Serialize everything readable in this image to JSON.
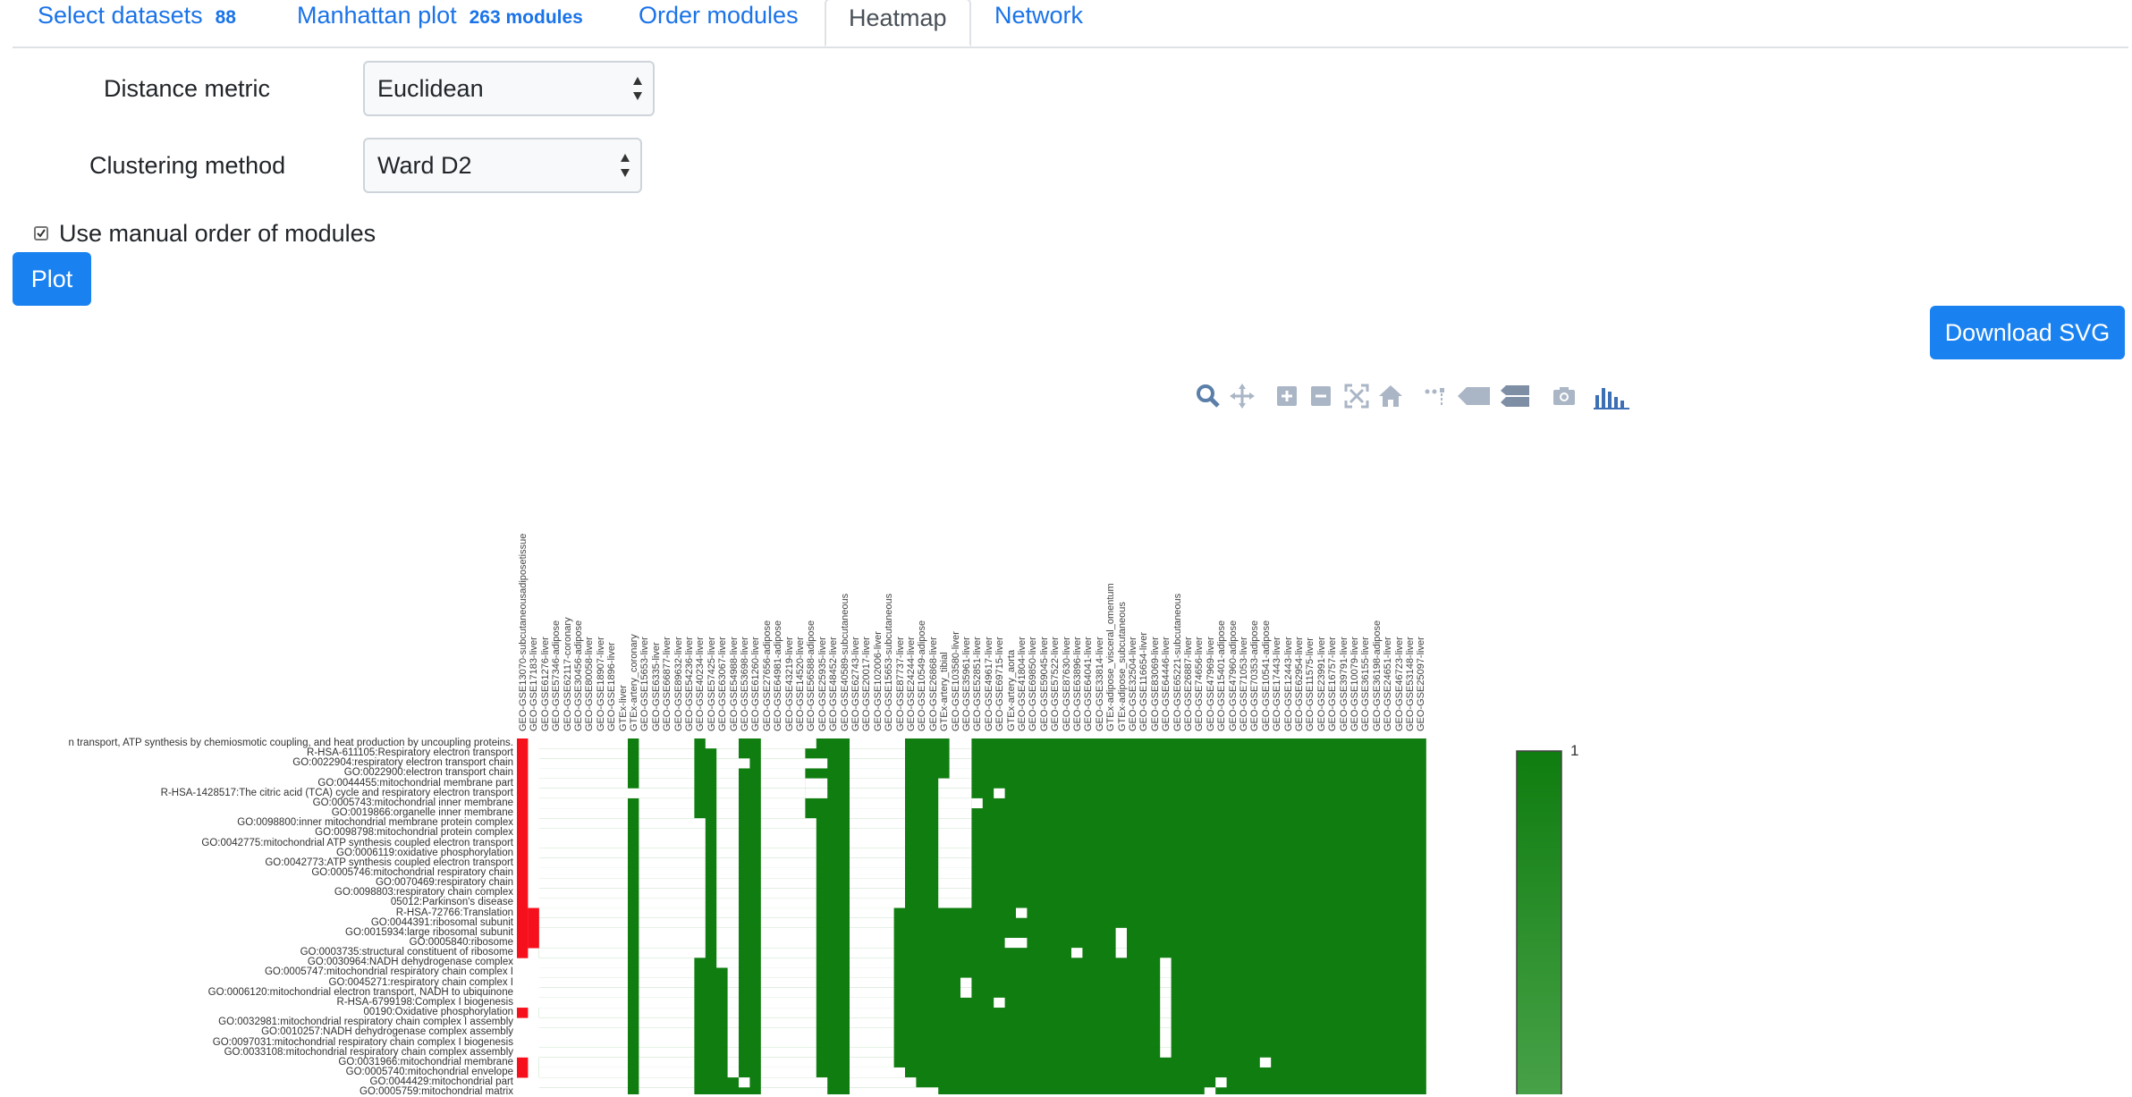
{
  "tabs": [
    {
      "label": "Select datasets",
      "badge": "88",
      "active": false
    },
    {
      "label": "Manhattan plot",
      "badge": "263 modules",
      "active": false
    },
    {
      "label": "Order modules",
      "badge": "",
      "active": false
    },
    {
      "label": "Heatmap",
      "badge": "",
      "active": true
    },
    {
      "label": "Network",
      "badge": "",
      "active": false
    }
  ],
  "form": {
    "distance_label": "Distance metric",
    "distance_value": "Euclidean",
    "clustering_label": "Clustering method",
    "clustering_value": "Ward D2",
    "manual_order_label": "Use manual order of modules",
    "manual_order_checked": true,
    "plot_button": "Plot",
    "download_button": "Download SVG"
  },
  "toolbar": {
    "icons": [
      "zoom-icon",
      "pan-icon",
      "zoom-in-icon",
      "zoom-out-icon",
      "autoscale-icon",
      "reset-axes-icon",
      "spike-lines-icon",
      "hover-closest-icon",
      "hover-compare-icon",
      "camera-icon",
      "plotly-logo-icon"
    ]
  },
  "colors": {
    "accent": "#1a82f0",
    "heat_green": "#0f7d0f",
    "heat_red": "#f5101c",
    "scale_light": "#4aa34a"
  },
  "heatmap": {
    "colorbar_max_label": "1",
    "columns": [
      "GEO-GSE13070-subcutaneousadiposetissue",
      "GEO-GSE17183-liver",
      "GEO-GSE61276-liver",
      "GEO-GSE57346-adipose",
      "GEO-GSE62117-coronary",
      "GEO-GSE30456-adipose",
      "GEO-GSE80058-liver",
      "GEO-GSE18907-liver",
      "GEO-GSE1896-liver",
      "GTEx-liver",
      "GTEx-artery_coronary",
      "GEO-GSE15653-liver",
      "GEO-GSE6335-liver",
      "GEO-GSE66877-liver",
      "GEO-GSE89632-liver",
      "GEO-GSE54236-liver",
      "GEO-GSE40234-liver",
      "GEO-GSE57425-liver",
      "GEO-GSE63067-liver",
      "GEO-GSE54988-liver",
      "GEO-GSE53698-liver",
      "GEO-GSE61260-liver",
      "GEO-GSE27656-adipose",
      "GEO-GSE64981-adipose",
      "GEO-GSE43219-liver",
      "GEO-GSE14520-liver",
      "GEO-GSE56588-adipose",
      "GEO-GSE25935-liver",
      "GEO-GSE48452-liver",
      "GEO-GSE40589-subcutaneous",
      "GEO-GSE62743-liver",
      "GEO-GSE20017-liver",
      "GEO-GSE102006-liver",
      "GEO-GSE15653-subcutaneous",
      "GEO-GSE87737-liver",
      "GEO-GSE24244-liver",
      "GEO-GSE10549-adipose",
      "GEO-GSE26868-liver",
      "GTEx-artery_tibial",
      "GEO-GSE103580-liver",
      "GEO-GSE35961-liver",
      "GEO-GSE52851-liver",
      "GEO-GSE49617-liver",
      "GEO-GSE69715-liver",
      "GTEx-artery_aorta",
      "GEO-GSE41804-liver",
      "GEO-GSE69850-liver",
      "GEO-GSE59045-liver",
      "GEO-GSE57522-liver",
      "GEO-GSE87630-liver",
      "GEO-GSE63896-liver",
      "GEO-GSE64041-liver",
      "GEO-GSE33814-liver",
      "GTEx-adipose_visceral_omentum",
      "GTEx-adipose_subcutaneous",
      "GEO-GSE32504-liver",
      "GEO-GSE116654-liver",
      "GEO-GSE83069-liver",
      "GEO-GSE64446-liver",
      "GEO-GSE65221-subcutaneous",
      "GEO-GSE26887-liver",
      "GEO-GSE74656-liver",
      "GEO-GSE47969-liver",
      "GEO-GSE15401-adipose",
      "GEO-GSE47960-adipose",
      "GEO-GSE71053-liver",
      "GEO-GSE70353-adipose",
      "GEO-GSE10541-adipose",
      "GEO-GSE17443-liver",
      "GEO-GSE12443-liver",
      "GEO-GSE62954-liver",
      "GEO-GSE11575-liver",
      "GEO-GSE23991-liver",
      "GEO-GSE16757-liver",
      "GEO-GSE39791-liver",
      "GEO-GSE10079-liver",
      "GEO-GSE36155-liver",
      "GEO-GSE36198-adipose",
      "GEO-GSE24651-liver",
      "GEO-GSE46723-liver",
      "GEO-GSE53148-liver",
      "GEO-GSE25097-liver"
    ],
    "rows": [
      "n transport, ATP synthesis by chemiosmotic coupling, and heat production by uncoupling proteins.",
      "R-HSA-611105:Respiratory electron transport",
      "GO:0022904:respiratory electron transport chain",
      "GO:0022900:electron transport chain",
      "GO:0044455:mitochondrial membrane part",
      "R-HSA-1428517:The citric acid (TCA) cycle and respiratory electron transport",
      "GO:0005743:mitochondrial inner membrane",
      "GO:0019866:organelle inner membrane",
      "GO:0098800:inner mitochondrial membrane protein complex",
      "GO:0098798:mitochondrial protein complex",
      "GO:0042775:mitochondrial ATP synthesis coupled electron transport",
      "GO:0006119:oxidative phosphorylation",
      "GO:0042773:ATP synthesis coupled electron transport",
      "GO:0005746:mitochondrial respiratory chain",
      "GO:0070469:respiratory chain",
      "GO:0098803:respiratory chain complex",
      "05012:Parkinson's disease",
      "R-HSA-72766:Translation",
      "GO:0044391:ribosomal subunit",
      "GO:0015934:large ribosomal subunit",
      "GO:0005840:ribosome",
      "GO:0003735:structural constituent of ribosome",
      "GO:0030964:NADH dehydrogenase complex",
      "GO:0005747:mitochondrial respiratory chain complex I",
      "GO:0045271:respiratory chain complex I",
      "GO:0006120:mitochondrial electron transport, NADH to ubiquinone",
      "R-HSA-6799198:Complex I biogenesis",
      "00190:Oxidative phosphorylation",
      "GO:0032981:mitochondrial respiratory chain complex I assembly",
      "GO:0010257:NADH dehydrogenase complex assembly",
      "GO:0097031:mitochondrial respiratory chain complex I biogenesis",
      "GO:0033108:mitochondrial respiratory chain complex assembly",
      "GO:0031966:mitochondrial membrane",
      "GO:0005740:mitochondrial envelope",
      "GO:0044429:mitochondrial part",
      "GO:0005759:mitochondrial matrix"
    ]
  },
  "chart_data": {
    "type": "heatmap",
    "x": "heatmap.columns",
    "y": "heatmap.rows",
    "zmax": 1,
    "colorscale": [
      "white",
      "green"
    ],
    "white_cells_by_row": [
      [
        [
          1,
          9
        ],
        [
          11,
          15
        ],
        [
          17,
          19
        ],
        [
          22,
          26
        ],
        [
          30,
          34
        ],
        [
          39,
          40
        ]
      ],
      [
        [
          1,
          9
        ],
        [
          11,
          15
        ],
        [
          18,
          19
        ],
        [
          22,
          25
        ],
        [
          30,
          34
        ],
        [
          39,
          40
        ]
      ],
      [
        [
          1,
          9
        ],
        [
          11,
          15
        ],
        [
          18,
          20
        ],
        [
          22,
          27
        ],
        [
          30,
          34
        ],
        [
          39,
          40
        ]
      ],
      [
        [
          1,
          9
        ],
        [
          11,
          15
        ],
        [
          18,
          19
        ],
        [
          22,
          25
        ],
        [
          30,
          34
        ],
        [
          39,
          40
        ]
      ],
      [
        [
          1,
          9
        ],
        [
          11,
          15
        ],
        [
          18,
          19
        ],
        [
          22,
          25
        ],
        [
          26,
          27
        ],
        [
          30,
          34
        ],
        [
          38,
          40
        ]
      ],
      [
        [
          1,
          9
        ],
        [
          10,
          15
        ],
        [
          18,
          19
        ],
        [
          22,
          25
        ],
        [
          26,
          27
        ],
        [
          30,
          34
        ],
        [
          38,
          40
        ],
        [
          43,
          43
        ]
      ],
      [
        [
          1,
          9
        ],
        [
          11,
          15
        ],
        [
          18,
          19
        ],
        [
          22,
          25
        ],
        [
          30,
          34
        ],
        [
          38,
          40
        ],
        [
          41,
          41
        ]
      ],
      [
        [
          1,
          9
        ],
        [
          11,
          15
        ],
        [
          18,
          19
        ],
        [
          22,
          25
        ],
        [
          30,
          34
        ],
        [
          38,
          40
        ]
      ],
      [
        [
          1,
          9
        ],
        [
          11,
          16
        ],
        [
          18,
          19
        ],
        [
          22,
          26
        ],
        [
          30,
          34
        ],
        [
          38,
          40
        ]
      ],
      [
        [
          1,
          9
        ],
        [
          11,
          16
        ],
        [
          18,
          19
        ],
        [
          22,
          26
        ],
        [
          30,
          34
        ],
        [
          38,
          40
        ]
      ],
      [
        [
          1,
          9
        ],
        [
          11,
          16
        ],
        [
          18,
          19
        ],
        [
          22,
          26
        ],
        [
          30,
          34
        ],
        [
          38,
          40
        ]
      ],
      [
        [
          1,
          9
        ],
        [
          11,
          16
        ],
        [
          18,
          19
        ],
        [
          22,
          26
        ],
        [
          30,
          34
        ],
        [
          38,
          40
        ]
      ],
      [
        [
          1,
          9
        ],
        [
          11,
          16
        ],
        [
          18,
          19
        ],
        [
          22,
          26
        ],
        [
          30,
          34
        ],
        [
          38,
          40
        ]
      ],
      [
        [
          1,
          9
        ],
        [
          11,
          16
        ],
        [
          18,
          19
        ],
        [
          22,
          26
        ],
        [
          30,
          34
        ],
        [
          38,
          40
        ]
      ],
      [
        [
          1,
          9
        ],
        [
          11,
          16
        ],
        [
          18,
          19
        ],
        [
          22,
          26
        ],
        [
          30,
          34
        ],
        [
          38,
          40
        ]
      ],
      [
        [
          1,
          9
        ],
        [
          11,
          16
        ],
        [
          18,
          19
        ],
        [
          22,
          26
        ],
        [
          30,
          34
        ],
        [
          38,
          40
        ]
      ],
      [
        [
          1,
          9
        ],
        [
          11,
          16
        ],
        [
          18,
          19
        ],
        [
          22,
          26
        ],
        [
          30,
          34
        ],
        [
          38,
          40
        ]
      ],
      [
        [
          2,
          9
        ],
        [
          11,
          16
        ],
        [
          18,
          19
        ],
        [
          22,
          26
        ],
        [
          30,
          33
        ],
        [
          45,
          45
        ]
      ],
      [
        [
          2,
          9
        ],
        [
          11,
          16
        ],
        [
          18,
          19
        ],
        [
          22,
          26
        ],
        [
          30,
          33
        ]
      ],
      [
        [
          2,
          9
        ],
        [
          11,
          16
        ],
        [
          18,
          19
        ],
        [
          22,
          26
        ],
        [
          30,
          33
        ],
        [
          54,
          54
        ]
      ],
      [
        [
          2,
          9
        ],
        [
          11,
          16
        ],
        [
          18,
          19
        ],
        [
          22,
          26
        ],
        [
          30,
          33
        ],
        [
          44,
          45
        ],
        [
          54,
          54
        ]
      ],
      [
        [
          2,
          9
        ],
        [
          11,
          16
        ],
        [
          18,
          19
        ],
        [
          22,
          26
        ],
        [
          30,
          33
        ],
        [
          50,
          50
        ],
        [
          54,
          54
        ]
      ],
      [
        [
          1,
          9
        ],
        [
          11,
          15
        ],
        [
          18,
          19
        ],
        [
          22,
          26
        ],
        [
          30,
          33
        ],
        [
          58,
          58
        ]
      ],
      [
        [
          1,
          9
        ],
        [
          11,
          15
        ],
        [
          19,
          19
        ],
        [
          22,
          26
        ],
        [
          30,
          33
        ],
        [
          58,
          58
        ]
      ],
      [
        [
          1,
          9
        ],
        [
          11,
          15
        ],
        [
          19,
          19
        ],
        [
          22,
          26
        ],
        [
          30,
          33
        ],
        [
          40,
          40
        ],
        [
          58,
          58
        ]
      ],
      [
        [
          1,
          9
        ],
        [
          11,
          15
        ],
        [
          19,
          19
        ],
        [
          22,
          26
        ],
        [
          30,
          33
        ],
        [
          40,
          40
        ],
        [
          58,
          58
        ]
      ],
      [
        [
          1,
          9
        ],
        [
          11,
          15
        ],
        [
          19,
          19
        ],
        [
          22,
          26
        ],
        [
          30,
          33
        ],
        [
          43,
          43
        ],
        [
          58,
          58
        ]
      ],
      [
        [
          2,
          9
        ],
        [
          11,
          15
        ],
        [
          19,
          19
        ],
        [
          22,
          26
        ],
        [
          30,
          33
        ],
        [
          58,
          58
        ]
      ],
      [
        [
          1,
          9
        ],
        [
          11,
          15
        ],
        [
          19,
          19
        ],
        [
          22,
          26
        ],
        [
          30,
          33
        ],
        [
          58,
          58
        ]
      ],
      [
        [
          1,
          9
        ],
        [
          11,
          15
        ],
        [
          19,
          19
        ],
        [
          22,
          26
        ],
        [
          30,
          33
        ],
        [
          58,
          58
        ]
      ],
      [
        [
          1,
          9
        ],
        [
          11,
          15
        ],
        [
          19,
          19
        ],
        [
          22,
          26
        ],
        [
          30,
          33
        ],
        [
          58,
          58
        ]
      ],
      [
        [
          1,
          9
        ],
        [
          11,
          15
        ],
        [
          19,
          19
        ],
        [
          22,
          26
        ],
        [
          30,
          33
        ],
        [
          58,
          58
        ]
      ],
      [
        [
          2,
          9
        ],
        [
          11,
          15
        ],
        [
          19,
          19
        ],
        [
          22,
          26
        ],
        [
          30,
          33
        ],
        [
          67,
          67
        ]
      ],
      [
        [
          2,
          9
        ],
        [
          11,
          15
        ],
        [
          19,
          19
        ],
        [
          22,
          26
        ],
        [
          30,
          34
        ]
      ],
      [
        [
          1,
          9
        ],
        [
          11,
          15
        ],
        [
          20,
          20
        ],
        [
          22,
          27
        ],
        [
          30,
          35
        ],
        [
          63,
          63
        ]
      ],
      [
        [
          1,
          9
        ],
        [
          11,
          15
        ],
        [
          22,
          27
        ],
        [
          30,
          37
        ],
        [
          62,
          62
        ]
      ]
    ],
    "red_cells_by_row": [
      [
        0
      ],
      [
        0
      ],
      [
        0
      ],
      [
        0
      ],
      [
        0
      ],
      [
        0
      ],
      [
        0
      ],
      [
        0
      ],
      [
        0
      ],
      [
        0
      ],
      [
        0
      ],
      [
        0
      ],
      [
        0
      ],
      [
        0
      ],
      [
        0
      ],
      [
        0
      ],
      [
        0
      ],
      [
        0,
        1
      ],
      [
        0,
        1
      ],
      [
        0,
        1
      ],
      [
        0,
        1
      ],
      [
        0
      ],
      [],
      [],
      [],
      [],
      [],
      [
        0
      ],
      [],
      [],
      [],
      [],
      [
        0
      ],
      [
        0
      ],
      [],
      []
    ]
  }
}
